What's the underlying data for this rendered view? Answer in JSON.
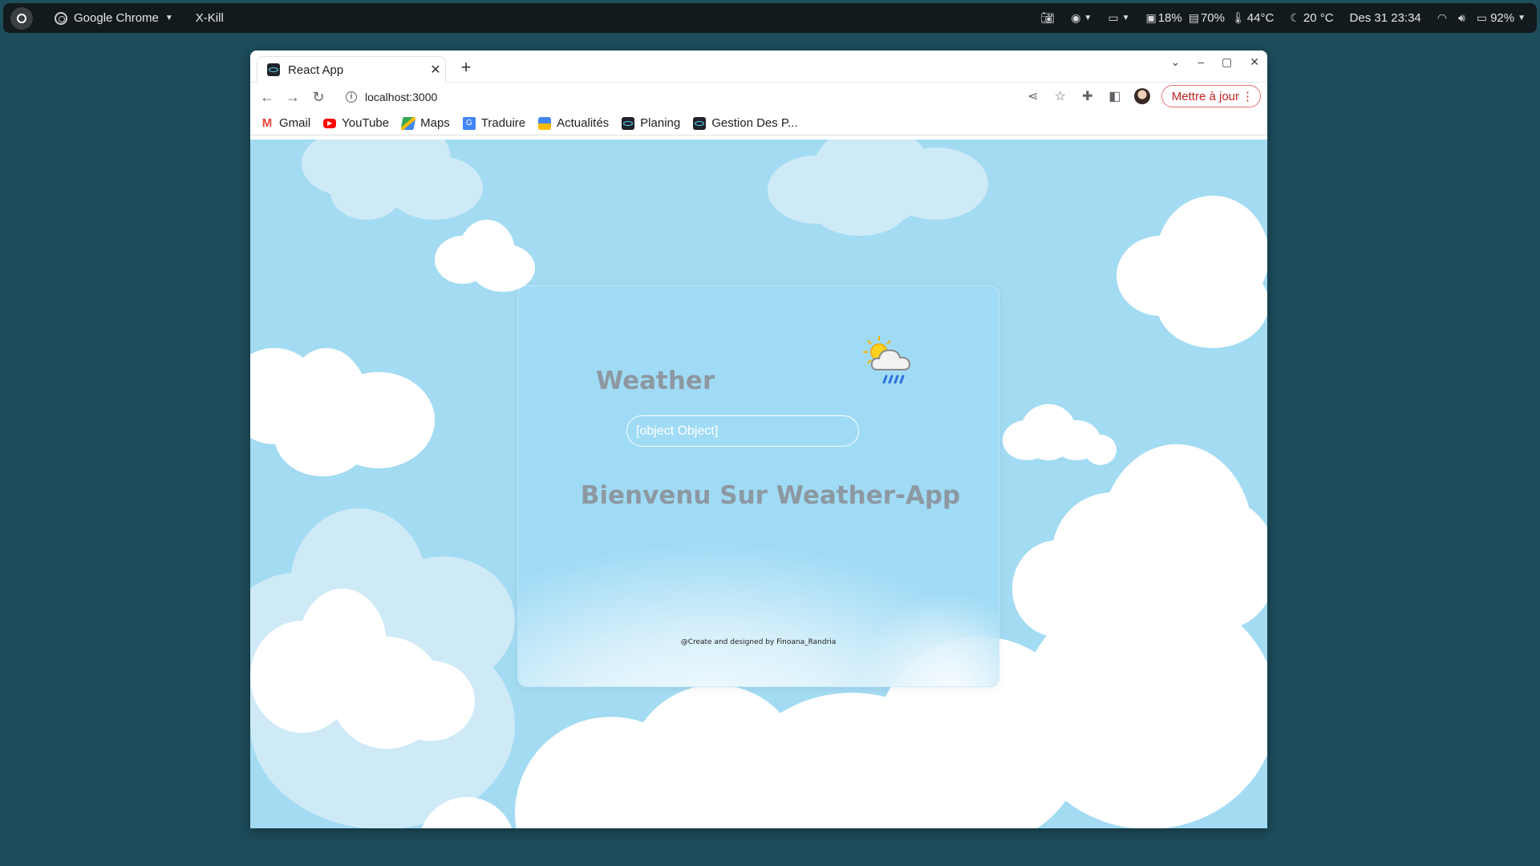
{
  "system_bar": {
    "app_name": "Google Chrome",
    "xkill_label": "X-Kill",
    "indicators": {
      "disk": "18%",
      "memory": "70%",
      "cpu_temp": "44°C",
      "weather": "20 °C",
      "datetime": "Des 31  23:34",
      "battery": "92%"
    }
  },
  "browser": {
    "tab_title": "React App",
    "url": "localhost:3000",
    "update_button": "Mettre à jour",
    "bookmarks": [
      {
        "label": "Gmail",
        "icon": "gmail-icon",
        "color": "#ea4335"
      },
      {
        "label": "YouTube",
        "icon": "youtube-icon",
        "color": "#ff0000"
      },
      {
        "label": "Maps",
        "icon": "maps-icon",
        "color": "#34a853"
      },
      {
        "label": "Traduire",
        "icon": "translate-icon",
        "color": "#4285f4"
      },
      {
        "label": "Actualités",
        "icon": "news-icon",
        "color": "#4285f4"
      },
      {
        "label": "Planing",
        "icon": "react-icon",
        "color": "#20232a"
      },
      {
        "label": "Gestion Des P...",
        "icon": "react-icon",
        "color": "#20232a"
      }
    ]
  },
  "page": {
    "title": "Weather",
    "search_value": "[object Object]",
    "welcome": "Bienvenu Sur Weather-App",
    "credit": "@Create and designed by Finoana_Randria"
  }
}
